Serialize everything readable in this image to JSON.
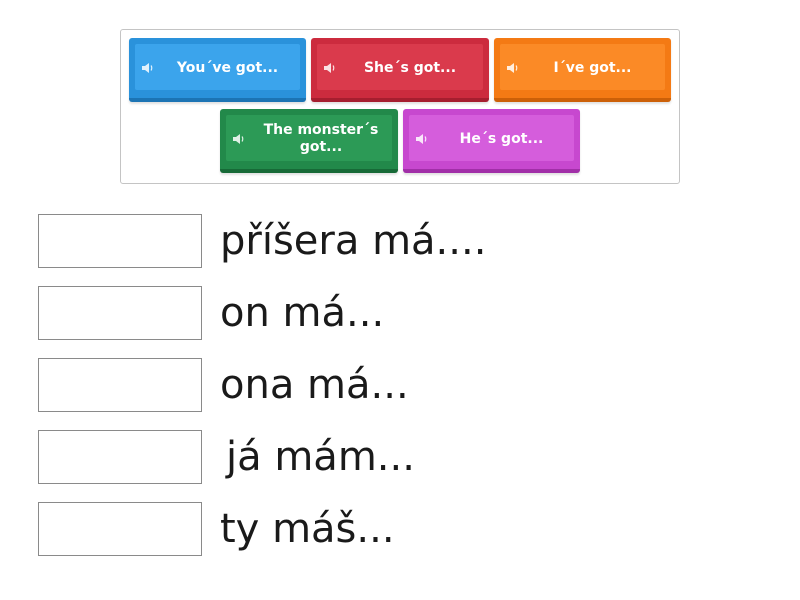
{
  "tiles": [
    {
      "label": "You´ve got...",
      "color": "#3ba4ec",
      "icon": "speaker-icon"
    },
    {
      "label": "She´s got...",
      "color": "#da3a4c",
      "icon": "speaker-icon"
    },
    {
      "label": "I´ve got...",
      "color": "#fb8a26",
      "icon": "speaker-icon"
    },
    {
      "label": "The monster´s got...",
      "color": "#2c9a56",
      "icon": "speaker-icon"
    },
    {
      "label": "He´s got...",
      "color": "#d55ddc",
      "icon": "speaker-icon"
    }
  ],
  "targets": [
    {
      "text": "příšera má...."
    },
    {
      "text": "on má..."
    },
    {
      "text": "ona má..."
    },
    {
      "text": "já mám..."
    },
    {
      "text": "ty máš..."
    }
  ]
}
